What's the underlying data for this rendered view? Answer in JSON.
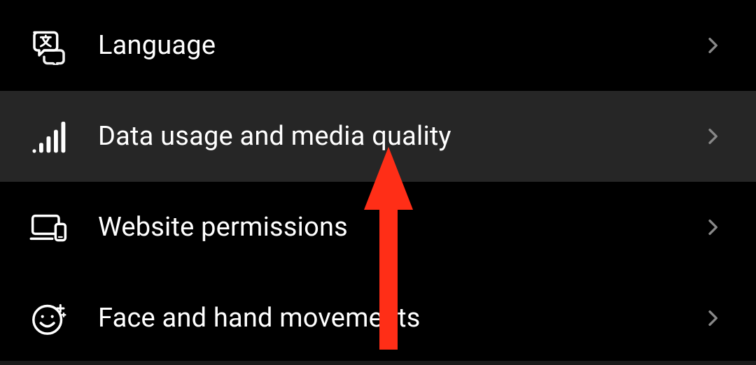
{
  "settings": {
    "items": [
      {
        "id": "language",
        "label": "Language",
        "icon": "translate-icon",
        "highlighted": false
      },
      {
        "id": "data-usage",
        "label": "Data usage and media quality",
        "icon": "signal-bars-icon",
        "highlighted": true
      },
      {
        "id": "website-permissions",
        "label": "Website permissions",
        "icon": "devices-icon",
        "highlighted": false
      },
      {
        "id": "face-hand-movements",
        "label": "Face and hand movements",
        "icon": "face-sparkle-icon",
        "highlighted": false
      }
    ]
  },
  "annotation": {
    "color": "#FF2E17"
  }
}
